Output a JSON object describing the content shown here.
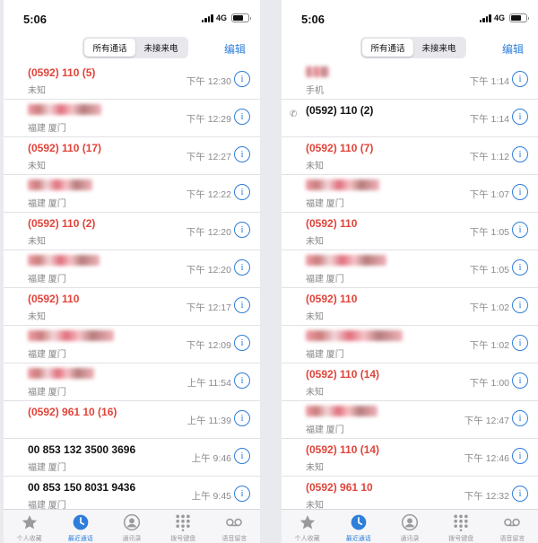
{
  "status": {
    "time": "5:06",
    "network": "4G"
  },
  "navbar": {
    "seg_all": "所有通话",
    "seg_missed": "未接来电",
    "edit": "编辑"
  },
  "colors": {
    "accent": "#2f7fda",
    "missed": "#e0443a"
  },
  "left_calls": [
    {
      "name": "(0592) 110 (5)",
      "sub": "未知",
      "time": "下午 12:30",
      "missed": true
    },
    {
      "name": "",
      "sub": "福建 厦门",
      "time": "下午 12:29",
      "missed": true
    },
    {
      "name": "(0592) 110 (17)",
      "sub": "未知",
      "time": "下午 12:27",
      "missed": true
    },
    {
      "name": "",
      "sub": "福建 厦门",
      "time": "下午 12:22",
      "missed": true
    },
    {
      "name": "(0592) 110 (2)",
      "sub": "未知",
      "time": "下午 12:20",
      "missed": true
    },
    {
      "name": "",
      "sub": "福建 厦门",
      "time": "下午 12:20",
      "missed": true
    },
    {
      "name": "(0592) 110",
      "sub": "未知",
      "time": "下午 12:17",
      "missed": true
    },
    {
      "name": "",
      "sub": "福建 厦门",
      "time": "下午 12:09",
      "missed": true
    },
    {
      "name": "",
      "sub": "福建 厦门",
      "time": "上午 11:54",
      "missed": true
    },
    {
      "name": "(0592) 961 10 (16)",
      "sub": "",
      "time": "上午 11:39",
      "missed": true
    },
    {
      "name": "00 853 132 3500 3696",
      "sub": "福建 厦门",
      "time": "上午 9:46",
      "missed": false
    },
    {
      "name": "00 853 150 8031 9436",
      "sub": "福建 厦门",
      "time": "上午 9:45",
      "missed": false
    }
  ],
  "right_calls": [
    {
      "name": "",
      "sub": "手机",
      "time": "下午 1:14",
      "missed": true
    },
    {
      "name": "(0592) 110 (2)",
      "sub": "",
      "time": "下午 1:14",
      "missed": false,
      "outgoing": true
    },
    {
      "name": "(0592) 110 (7)",
      "sub": "未知",
      "time": "下午 1:12",
      "missed": true
    },
    {
      "name": "",
      "sub": "福建 厦门",
      "time": "下午 1:07",
      "missed": true
    },
    {
      "name": "(0592) 110",
      "sub": "未知",
      "time": "下午 1:05",
      "missed": true
    },
    {
      "name": "",
      "sub": "福建 厦门",
      "time": "下午 1:05",
      "missed": true
    },
    {
      "name": "(0592) 110",
      "sub": "未知",
      "time": "下午 1:02",
      "missed": true
    },
    {
      "name": "",
      "sub": "福建 厦门",
      "time": "下午 1:02",
      "missed": true
    },
    {
      "name": "(0592) 110 (14)",
      "sub": "未知",
      "time": "下午 1:00",
      "missed": true
    },
    {
      "name": "",
      "sub": "福建 厦门",
      "time": "下午 12:47",
      "missed": true
    },
    {
      "name": "(0592) 110 (14)",
      "sub": "未知",
      "time": "下午 12:46",
      "missed": true
    },
    {
      "name": "(0592) 961 10",
      "sub": "未知",
      "time": "下午 12:32",
      "missed": true
    }
  ],
  "tabs": [
    {
      "label": "个人收藏",
      "icon": "star-icon"
    },
    {
      "label": "最近通话",
      "icon": "clock-icon",
      "active": true
    },
    {
      "label": "通讯录",
      "icon": "contacts-icon"
    },
    {
      "label": "拨号键盘",
      "icon": "keypad-icon"
    },
    {
      "label": "语音留言",
      "icon": "voicemail-icon"
    }
  ]
}
